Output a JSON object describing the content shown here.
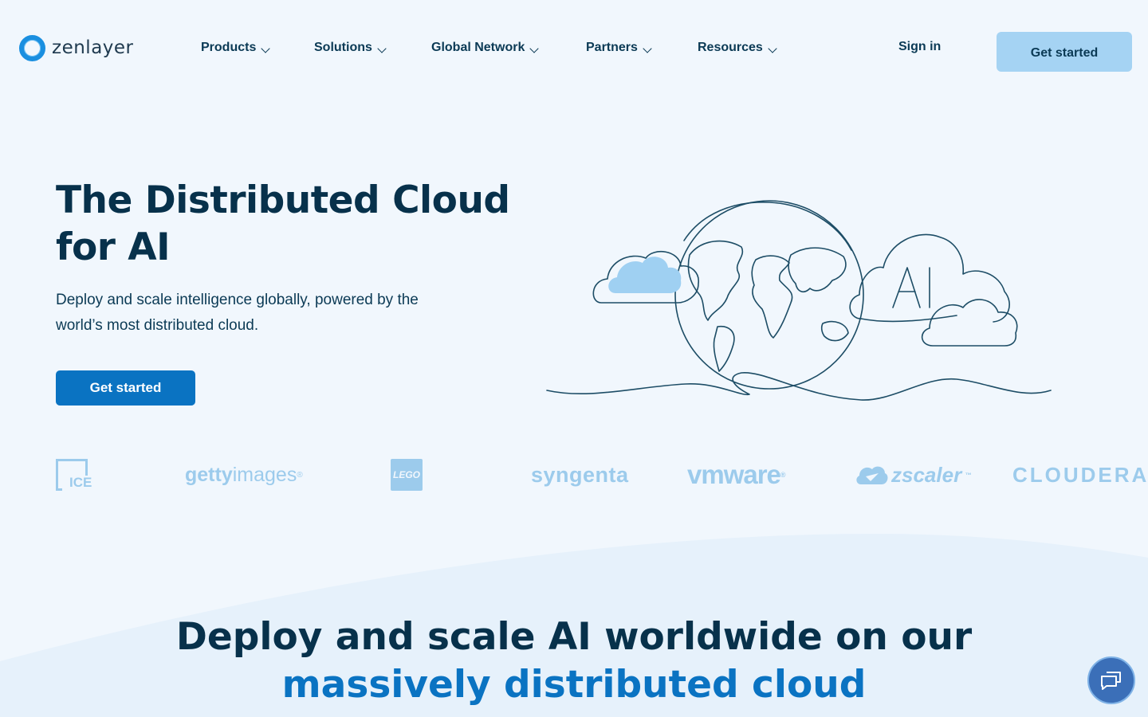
{
  "brand": {
    "name": "zenlayer",
    "accent": "#0a73c2",
    "accent_light": "#a5d3f3",
    "text_dark": "#07314b",
    "background": "#f1f7fd"
  },
  "nav": {
    "items": [
      {
        "label": "Products",
        "icon": "chevron-down-icon"
      },
      {
        "label": "Solutions",
        "icon": "chevron-down-icon"
      },
      {
        "label": "Global Network",
        "icon": "chevron-down-icon"
      },
      {
        "label": "Partners",
        "icon": "chevron-down-icon"
      },
      {
        "label": "Resources",
        "icon": "chevron-down-icon"
      }
    ],
    "sign_in": "Sign in",
    "cta": "Get started"
  },
  "hero": {
    "title_line1": "The Distributed Cloud",
    "title_line2": "for AI",
    "subtitle_line1": "Deploy and scale intelligence globally, powered by the",
    "subtitle_line2": "world’s most distributed cloud.",
    "cta": "Get started",
    "illustration_text": "AI"
  },
  "clients": {
    "ice": "ICE",
    "getty_a": "getty",
    "getty_b": "images",
    "lego": "LEGO",
    "syngenta": "syngenta",
    "vmware": "vmware",
    "zscaler": "zscaler",
    "cloudera": "CLOUDERA"
  },
  "section": {
    "title_line1": "Deploy and scale AI worldwide on our",
    "title_line2": "massively distributed cloud"
  },
  "chat": {
    "icon": "chat-bubbles-icon"
  }
}
